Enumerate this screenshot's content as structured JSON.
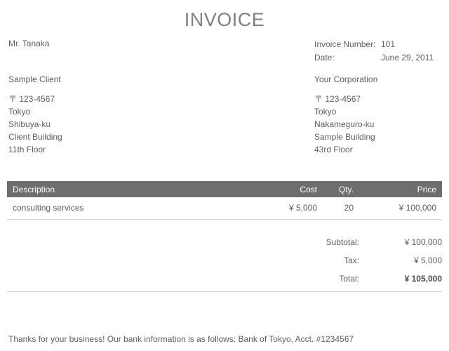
{
  "document": {
    "title": "INVOICE",
    "greeting": "Mr. Tanaka"
  },
  "meta": {
    "invoice_number_label": "Invoice Number:",
    "invoice_number_value": "101",
    "date_label": "Date:",
    "date_value": "June 29, 2011"
  },
  "client": {
    "name": "Sample Client",
    "lines": [
      "〒 123-4567",
      "Tokyo",
      "Shibuya-ku",
      "Client Building",
      "11th Floor"
    ]
  },
  "company": {
    "name": "Your Corporation",
    "lines": [
      "〒 123-4567",
      "Tokyo",
      "Nakameguro-ku",
      "Sample Building",
      "43rd Floor"
    ]
  },
  "items_table": {
    "columns": [
      "Description",
      "Cost",
      "Qty.",
      "Price"
    ],
    "rows": [
      {
        "description": "consulting services",
        "cost": "¥ 5,000",
        "qty": "20",
        "price": "¥ 100,000"
      }
    ]
  },
  "totals": {
    "subtotal_label": "Subtotal:",
    "subtotal_value": "¥ 100,000",
    "tax_label": "Tax:",
    "tax_value": "¥ 5,000",
    "total_label": "Total:",
    "total_value": "¥ 105,000"
  },
  "footer": {
    "note": "Thanks for your business! Our bank information is as follows: Bank of Tokyo, Acct. #1234567"
  },
  "colors": {
    "header_bar": "#6e6e6e",
    "title_text": "#808080",
    "body_text": "#5f5f5f",
    "rule": "#d4d4d4"
  }
}
